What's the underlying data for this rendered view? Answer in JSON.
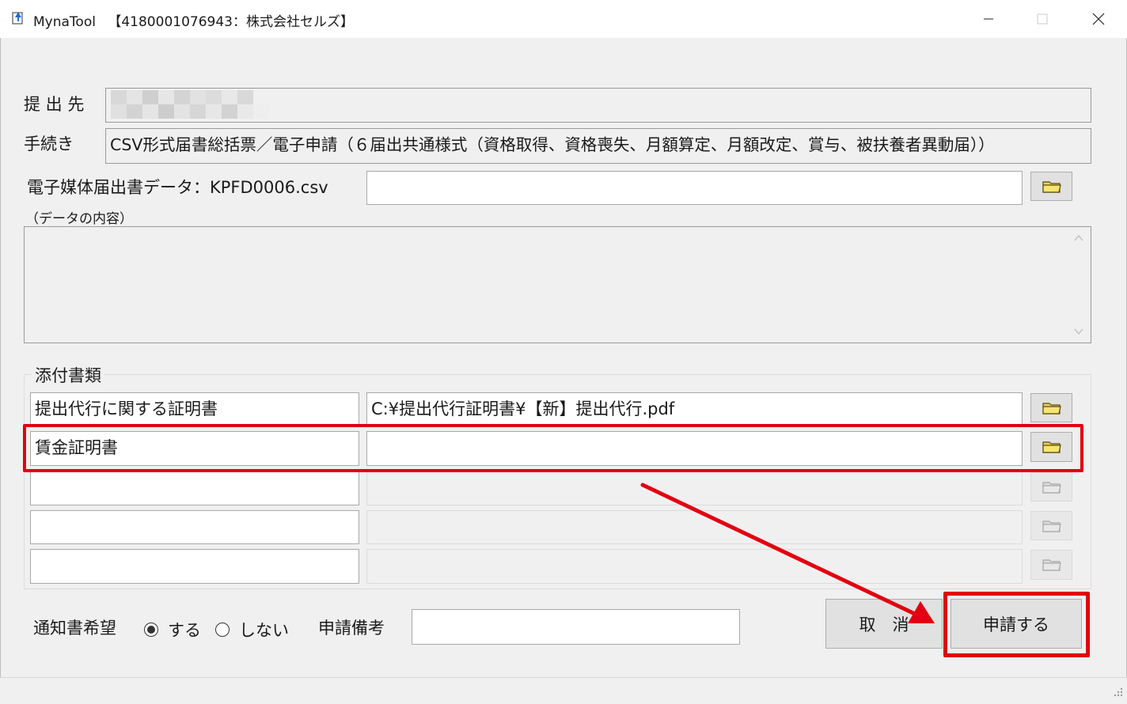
{
  "window": {
    "app_name": "MynaTool",
    "title_info": "【4180001076943：株式会社セルズ】",
    "minimize": "—",
    "maximize": "☐",
    "close": "✕"
  },
  "form": {
    "submit_to_label": "提 出 先",
    "procedure_label": "手続き",
    "procedure_value": "CSV形式届書総括票／電子申請（６届出共通様式（資格取得、資格喪失、月額算定、月額改定、賞与、被扶養者異動届））",
    "media_data_label": "電子媒体届出書データ：KPFD0006.csv",
    "media_data_value": "",
    "data_contents_label": "（データの内容）",
    "data_contents_value": ""
  },
  "attachments": {
    "group_label": "添付書類",
    "rows": [
      {
        "name": "提出代行に関する証明書",
        "path": "C:¥提出代行証明書¥【新】提出代行.pdf",
        "enabled": true
      },
      {
        "name": "賃金証明書",
        "path": "",
        "enabled": true
      },
      {
        "name": "",
        "path": "",
        "enabled": false
      },
      {
        "name": "",
        "path": "",
        "enabled": false
      },
      {
        "name": "",
        "path": "",
        "enabled": false
      }
    ]
  },
  "notice": {
    "label": "通知書希望",
    "option_yes": "する",
    "option_no": "しない",
    "selected": "する",
    "remarks_label": "申請備考",
    "remarks_value": ""
  },
  "buttons": {
    "cancel": "取　消",
    "apply": "申請する"
  },
  "annotations": {
    "highlight_color": "#e00012"
  },
  "icons": {
    "folder": "folder-icon",
    "app": "app-icon"
  }
}
